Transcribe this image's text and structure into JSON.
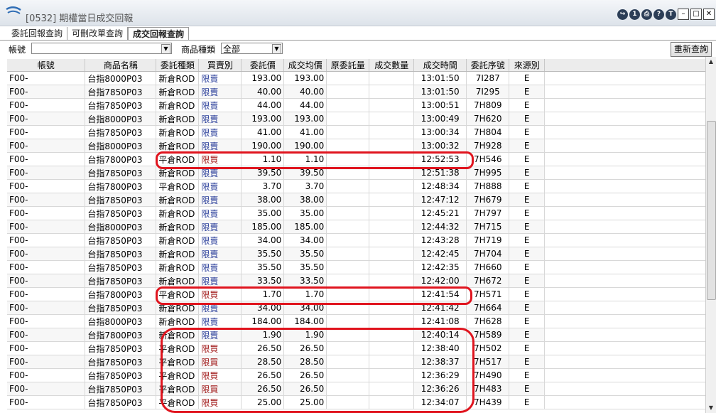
{
  "window": {
    "title": "[0532] 期權當日成交回報"
  },
  "toolbar_icons": [
    "↪",
    "1",
    "⎙",
    "?",
    "T"
  ],
  "tabs": [
    {
      "label": "委託回報查詢",
      "active": false
    },
    {
      "label": "可刪改單查詢",
      "active": false
    },
    {
      "label": "成交回報查詢",
      "active": true
    }
  ],
  "filter": {
    "account_label": "帳號",
    "product_type_label": "商品種類",
    "product_type_value": "全部",
    "refresh_label": "重新查詢"
  },
  "columns": [
    "帳號",
    "商品名稱",
    "委託種類",
    "買賣別",
    "委託價",
    "成交均價",
    "原委託量",
    "成交數量",
    "成交時間",
    "委託序號",
    "來源別"
  ],
  "rows": [
    [
      "F00-",
      "台指8000P03",
      "新倉ROD",
      "限賣",
      "193.00",
      "193.00",
      "",
      "",
      "13:01:50",
      "7I287",
      "E"
    ],
    [
      "F00-",
      "台指7850P03",
      "新倉ROD",
      "限賣",
      "40.00",
      "40.00",
      "",
      "",
      "13:01:50",
      "7I295",
      "E"
    ],
    [
      "F00-",
      "台指7850P03",
      "新倉ROD",
      "限賣",
      "44.00",
      "44.00",
      "",
      "",
      "13:00:51",
      "7H809",
      "E"
    ],
    [
      "F00-",
      "台指8000P03",
      "新倉ROD",
      "限賣",
      "193.00",
      "193.00",
      "",
      "",
      "13:00:49",
      "7H620",
      "E"
    ],
    [
      "F00-",
      "台指7850P03",
      "新倉ROD",
      "限賣",
      "41.00",
      "41.00",
      "",
      "",
      "13:00:34",
      "7H804",
      "E"
    ],
    [
      "F00-",
      "台指8000P03",
      "新倉ROD",
      "限賣",
      "190.00",
      "190.00",
      "",
      "",
      "13:00:32",
      "7H928",
      "E"
    ],
    [
      "F00-",
      "台指7800P03",
      "平倉ROD",
      "限買",
      "1.10",
      "1.10",
      "",
      "",
      "12:52:53",
      "7H546",
      "E"
    ],
    [
      "F00-",
      "台指7850P03",
      "新倉ROD",
      "限賣",
      "39.50",
      "39.50",
      "",
      "",
      "12:51:38",
      "7H995",
      "E"
    ],
    [
      "F00-",
      "台指7800P03",
      "平倉ROD",
      "限賣",
      "3.70",
      "3.70",
      "",
      "",
      "12:48:34",
      "7H888",
      "E"
    ],
    [
      "F00-",
      "台指7850P03",
      "新倉ROD",
      "限賣",
      "38.00",
      "38.00",
      "",
      "",
      "12:47:12",
      "7H679",
      "E"
    ],
    [
      "F00-",
      "台指7850P03",
      "新倉ROD",
      "限賣",
      "35.00",
      "35.00",
      "",
      "",
      "12:45:21",
      "7H797",
      "E"
    ],
    [
      "F00-",
      "台指8000P03",
      "新倉ROD",
      "限賣",
      "185.00",
      "185.00",
      "",
      "",
      "12:44:32",
      "7H715",
      "E"
    ],
    [
      "F00-",
      "台指7850P03",
      "新倉ROD",
      "限賣",
      "34.00",
      "34.00",
      "",
      "",
      "12:43:28",
      "7H719",
      "E"
    ],
    [
      "F00-",
      "台指7850P03",
      "新倉ROD",
      "限賣",
      "35.50",
      "35.50",
      "",
      "",
      "12:42:45",
      "7H704",
      "E"
    ],
    [
      "F00-",
      "台指7850P03",
      "新倉ROD",
      "限賣",
      "35.50",
      "35.50",
      "",
      "",
      "12:42:35",
      "7H660",
      "E"
    ],
    [
      "F00-",
      "台指7850P03",
      "新倉ROD",
      "限賣",
      "33.50",
      "33.50",
      "",
      "",
      "12:42:00",
      "7H672",
      "E"
    ],
    [
      "F00-",
      "台指7800P03",
      "平倉ROD",
      "限買",
      "1.70",
      "1.70",
      "",
      "",
      "12:41:54",
      "7H571",
      "E"
    ],
    [
      "F00-",
      "台指7850P03",
      "新倉ROD",
      "限賣",
      "34.00",
      "34.00",
      "",
      "",
      "12:41:42",
      "7H664",
      "E"
    ],
    [
      "F00-",
      "台指8000P03",
      "新倉ROD",
      "限賣",
      "184.00",
      "184.00",
      "",
      "",
      "12:41:08",
      "7H628",
      "E"
    ],
    [
      "F00-",
      "台指7800P03",
      "新倉ROD",
      "限賣",
      "1.90",
      "1.90",
      "",
      "",
      "12:40:14",
      "7H589",
      "E"
    ],
    [
      "F00-",
      "台指7850P03",
      "平倉ROD",
      "限買",
      "26.50",
      "26.50",
      "",
      "",
      "12:38:40",
      "7H502",
      "E"
    ],
    [
      "F00-",
      "台指7850P03",
      "平倉ROD",
      "限買",
      "28.50",
      "28.50",
      "",
      "",
      "12:38:37",
      "7H517",
      "E"
    ],
    [
      "F00-",
      "台指7850P03",
      "平倉ROD",
      "限買",
      "26.50",
      "26.50",
      "",
      "",
      "12:36:29",
      "7H490",
      "E"
    ],
    [
      "F00-",
      "台指7850P03",
      "平倉ROD",
      "限買",
      "26.50",
      "26.50",
      "",
      "",
      "12:36:26",
      "7H483",
      "E"
    ],
    [
      "F00-",
      "台指7850P03",
      "平倉ROD",
      "限買",
      "25.00",
      "25.00",
      "",
      "",
      "12:34:07",
      "7H439",
      "E"
    ]
  ],
  "colors": {
    "buy_text": "#a11a1a",
    "sell_text": "#2a3e9a",
    "annotation": "#e0141e"
  }
}
